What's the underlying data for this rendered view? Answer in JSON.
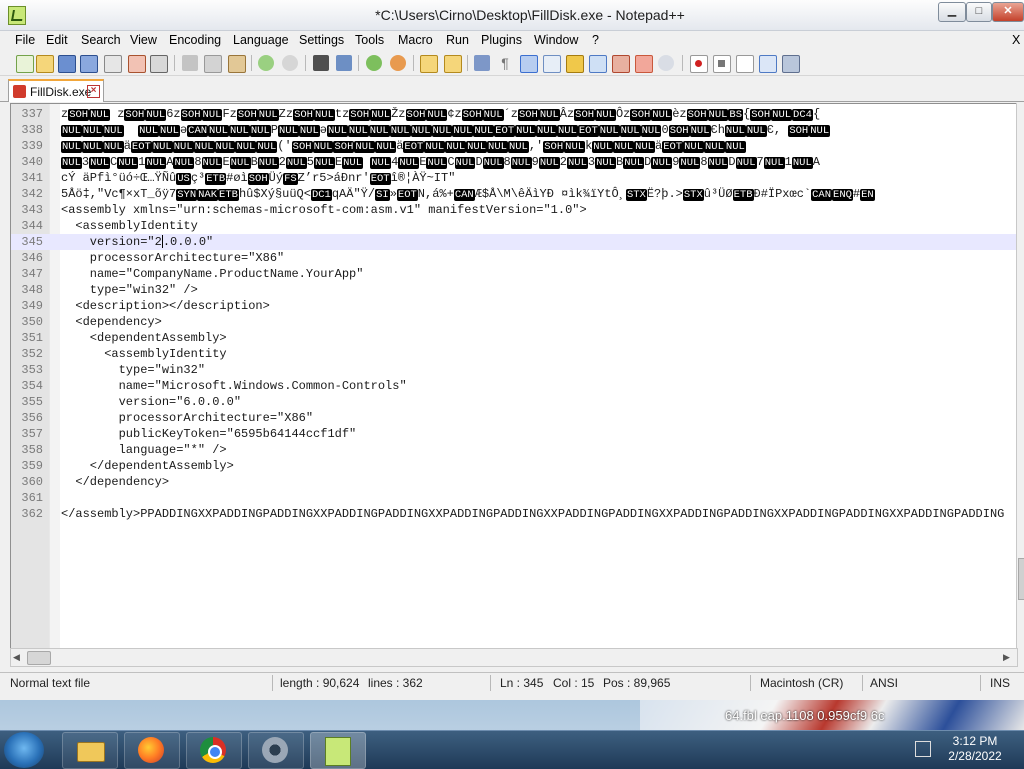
{
  "window": {
    "title": "*C:\\Users\\Cirno\\Desktop\\FillDisk.exe - Notepad++"
  },
  "menu": [
    "File",
    "Edit",
    "Search",
    "View",
    "Encoding",
    "Language",
    "Settings",
    "Tools",
    "Macro",
    "Run",
    "Plugins",
    "Window",
    "?"
  ],
  "tab": {
    "label": "FillDisk.exe"
  },
  "editor": {
    "lines": [
      {
        "num": "337",
        "segments": [
          {
            "t": "z"
          },
          {
            "t": "SOH",
            "c": 1
          },
          {
            "t": "NUL",
            "c": 1
          },
          {
            "t": " z"
          },
          {
            "t": "SOH",
            "c": 1
          },
          {
            "t": "NUL",
            "c": 1
          },
          {
            "t": "6z"
          },
          {
            "t": "SOH",
            "c": 1
          },
          {
            "t": "NUL",
            "c": 1
          },
          {
            "t": "Fz"
          },
          {
            "t": "SOH",
            "c": 1
          },
          {
            "t": "NUL",
            "c": 1
          },
          {
            "t": "Zz"
          },
          {
            "t": "SOH",
            "c": 1
          },
          {
            "t": "NUL",
            "c": 1
          },
          {
            "t": "tz"
          },
          {
            "t": "SOH",
            "c": 1
          },
          {
            "t": "NUL",
            "c": 1
          },
          {
            "t": "Žz"
          },
          {
            "t": "SOH",
            "c": 1
          },
          {
            "t": "NUL",
            "c": 1
          },
          {
            "t": "¢z"
          },
          {
            "t": "SOH",
            "c": 1
          },
          {
            "t": "NUL",
            "c": 1
          },
          {
            "t": "´z"
          },
          {
            "t": "SOH",
            "c": 1
          },
          {
            "t": "NUL",
            "c": 1
          },
          {
            "t": "Âz"
          },
          {
            "t": "SOH",
            "c": 1
          },
          {
            "t": "NUL",
            "c": 1
          },
          {
            "t": "Ôz"
          },
          {
            "t": "SOH",
            "c": 1
          },
          {
            "t": "NUL",
            "c": 1
          },
          {
            "t": "èz"
          },
          {
            "t": "SOH",
            "c": 1
          },
          {
            "t": "NUL",
            "c": 1
          },
          {
            "t": "BS",
            "c": 1
          },
          {
            "t": "{"
          },
          {
            "t": "SOH",
            "c": 1
          },
          {
            "t": "NUL",
            "c": 1
          },
          {
            "t": "DC4",
            "c": 1
          },
          {
            "t": "{"
          }
        ]
      },
      {
        "num": "338",
        "segments": [
          {
            "t": "NUL",
            "c": 1
          },
          {
            "t": "NUL",
            "c": 1
          },
          {
            "t": "NUL",
            "c": 1
          },
          {
            "t": "  "
          },
          {
            "t": "NUL",
            "c": 1
          },
          {
            "t": "NUL",
            "c": 1
          },
          {
            "t": "ә"
          },
          {
            "t": "CAN",
            "c": 1
          },
          {
            "t": "NUL",
            "c": 1
          },
          {
            "t": "NUL",
            "c": 1
          },
          {
            "t": "NUL",
            "c": 1
          },
          {
            "t": "P"
          },
          {
            "t": "NUL",
            "c": 1
          },
          {
            "t": "NUL",
            "c": 1
          },
          {
            "t": "ә"
          },
          {
            "t": "NUL",
            "c": 1
          },
          {
            "t": "NUL",
            "c": 1
          },
          {
            "t": "NUL",
            "c": 1
          },
          {
            "t": "NUL",
            "c": 1
          },
          {
            "t": "NUL",
            "c": 1
          },
          {
            "t": "NUL",
            "c": 1
          },
          {
            "t": "NUL",
            "c": 1
          },
          {
            "t": "NUL",
            "c": 1
          },
          {
            "t": "EOT",
            "c": 1
          },
          {
            "t": "NUL",
            "c": 1
          },
          {
            "t": "NUL",
            "c": 1
          },
          {
            "t": "NUL",
            "c": 1
          },
          {
            "t": "EOT",
            "c": 1
          },
          {
            "t": "NUL",
            "c": 1
          },
          {
            "t": "NUL",
            "c": 1
          },
          {
            "t": "NUL",
            "c": 1
          },
          {
            "t": "0"
          },
          {
            "t": "SOH",
            "c": 1
          },
          {
            "t": "NUL",
            "c": 1
          },
          {
            "t": "Єh"
          },
          {
            "t": "NUL",
            "c": 1
          },
          {
            "t": "NUL",
            "c": 1
          },
          {
            "t": "Є, "
          },
          {
            "t": "SOH",
            "c": 1
          },
          {
            "t": "NUL",
            "c": 1
          }
        ]
      },
      {
        "num": "339",
        "segments": [
          {
            "t": "NUL",
            "c": 1
          },
          {
            "t": "NUL",
            "c": 1
          },
          {
            "t": "NUL",
            "c": 1
          },
          {
            "t": "ä"
          },
          {
            "t": "EOT",
            "c": 1
          },
          {
            "t": "NUL",
            "c": 1
          },
          {
            "t": "NUL",
            "c": 1
          },
          {
            "t": "NUL",
            "c": 1
          },
          {
            "t": "NUL",
            "c": 1
          },
          {
            "t": "NUL",
            "c": 1
          },
          {
            "t": "NUL",
            "c": 1
          },
          {
            "t": "('"
          },
          {
            "t": "SOH",
            "c": 1
          },
          {
            "t": "NUL",
            "c": 1
          },
          {
            "t": "SOH",
            "c": 1
          },
          {
            "t": "NUL",
            "c": 1
          },
          {
            "t": "NUL",
            "c": 1
          },
          {
            "t": "ä"
          },
          {
            "t": "EOT",
            "c": 1
          },
          {
            "t": "NUL",
            "c": 1
          },
          {
            "t": "NUL",
            "c": 1
          },
          {
            "t": "NUL",
            "c": 1
          },
          {
            "t": "NUL",
            "c": 1
          },
          {
            "t": "NUL",
            "c": 1
          },
          {
            "t": ",'"
          },
          {
            "t": "SOH",
            "c": 1
          },
          {
            "t": "NUL",
            "c": 1
          },
          {
            "t": "k"
          },
          {
            "t": "NUL",
            "c": 1
          },
          {
            "t": "NUL",
            "c": 1
          },
          {
            "t": "NUL",
            "c": 1
          },
          {
            "t": "ä"
          },
          {
            "t": "EOT",
            "c": 1
          },
          {
            "t": "NUL",
            "c": 1
          },
          {
            "t": "NUL",
            "c": 1
          },
          {
            "t": "NUL",
            "c": 1
          }
        ]
      },
      {
        "num": "340",
        "segments": [
          {
            "t": "NUL",
            "c": 1
          },
          {
            "t": "3"
          },
          {
            "t": "NUL",
            "c": 1
          },
          {
            "t": "C"
          },
          {
            "t": "NUL",
            "c": 1
          },
          {
            "t": "1"
          },
          {
            "t": "NUL",
            "c": 1
          },
          {
            "t": "A"
          },
          {
            "t": "NUL",
            "c": 1
          },
          {
            "t": "8"
          },
          {
            "t": "NUL",
            "c": 1
          },
          {
            "t": "E"
          },
          {
            "t": "NUL",
            "c": 1
          },
          {
            "t": "B"
          },
          {
            "t": "NUL",
            "c": 1
          },
          {
            "t": "2"
          },
          {
            "t": "NUL",
            "c": 1
          },
          {
            "t": "5"
          },
          {
            "t": "NUL",
            "c": 1
          },
          {
            "t": "E"
          },
          {
            "t": "NUL",
            "c": 1
          },
          {
            "t": " "
          },
          {
            "t": "NUL",
            "c": 1
          },
          {
            "t": "4"
          },
          {
            "t": "NUL",
            "c": 1
          },
          {
            "t": "E"
          },
          {
            "t": "NUL",
            "c": 1
          },
          {
            "t": "C"
          },
          {
            "t": "NUL",
            "c": 1
          },
          {
            "t": "D"
          },
          {
            "t": "NUL",
            "c": 1
          },
          {
            "t": "8"
          },
          {
            "t": "NUL",
            "c": 1
          },
          {
            "t": "9"
          },
          {
            "t": "NUL",
            "c": 1
          },
          {
            "t": "2"
          },
          {
            "t": "NUL",
            "c": 1
          },
          {
            "t": "3"
          },
          {
            "t": "NUL",
            "c": 1
          },
          {
            "t": "B"
          },
          {
            "t": "NUL",
            "c": 1
          },
          {
            "t": "D"
          },
          {
            "t": "NUL",
            "c": 1
          },
          {
            "t": "9"
          },
          {
            "t": "NUL",
            "c": 1
          },
          {
            "t": "8"
          },
          {
            "t": "NUL",
            "c": 1
          },
          {
            "t": "D"
          },
          {
            "t": "NUL",
            "c": 1
          },
          {
            "t": "7"
          },
          {
            "t": "NUL",
            "c": 1
          },
          {
            "t": "1"
          },
          {
            "t": "NUL",
            "c": 1
          },
          {
            "t": "A"
          }
        ]
      },
      {
        "num": "341",
        "segments": [
          {
            "t": "cÝ äPfì°üó÷Œ…ŸÑû"
          },
          {
            "t": "US",
            "c": 1
          },
          {
            "t": "ç³"
          },
          {
            "t": "ETB",
            "c": 1
          },
          {
            "t": "#øì"
          },
          {
            "t": "SOH",
            "c": 1
          },
          {
            "t": "Üý"
          },
          {
            "t": "FS",
            "c": 1
          },
          {
            "t": "Z’r5>áÐnr'"
          },
          {
            "t": "EOT",
            "c": 1
          },
          {
            "t": "î®¦ÀŸ~IT\""
          }
        ]
      },
      {
        "num": "342",
        "segments": [
          {
            "t": "5Åö‡,\"Vc¶×xT_õÿ7"
          },
          {
            "t": "SYN",
            "c": 1
          },
          {
            "t": "NAK",
            "c": 1
          },
          {
            "t": "ETB",
            "c": 1
          },
          {
            "t": "hû$Xý§uüQ<"
          },
          {
            "t": "DC1",
            "c": 1
          },
          {
            "t": "qAÄ\"Ÿ/"
          },
          {
            "t": "SI",
            "c": 1
          },
          {
            "t": "»"
          },
          {
            "t": "EOT",
            "c": 1
          },
          {
            "t": "N,á%+"
          },
          {
            "t": "CAN",
            "c": 1
          },
          {
            "t": "Æ$Å\\M\\êÄìYÐ ¤ìk¾ïYtÔ¸"
          },
          {
            "t": "STX",
            "c": 1
          },
          {
            "t": "Ë?þ.>"
          },
          {
            "t": "STX",
            "c": 1
          },
          {
            "t": "û³ÜØ"
          },
          {
            "t": "ETB",
            "c": 1
          },
          {
            "t": "Ð#ÏPxœc`"
          },
          {
            "t": "CAN",
            "c": 1
          },
          {
            "t": "ENQ",
            "c": 1
          },
          {
            "t": "#"
          },
          {
            "t": "EN",
            "c": 1
          }
        ]
      },
      {
        "num": "343",
        "segments": [
          {
            "t": "<assembly xmlns=\"urn:schemas-microsoft-com:asm.v1\" manifestVersion=\"1.0\">"
          }
        ]
      },
      {
        "num": "344",
        "segments": [
          {
            "t": "  <assemblyIdentity"
          }
        ]
      },
      {
        "num": "345",
        "current": true,
        "before": "    version=\"2",
        "after": ".0.0.0\""
      },
      {
        "num": "346",
        "segments": [
          {
            "t": "    processorArchitecture=\"X86\""
          }
        ]
      },
      {
        "num": "347",
        "segments": [
          {
            "t": "    name=\"CompanyName.ProductName.YourApp\""
          }
        ]
      },
      {
        "num": "348",
        "segments": [
          {
            "t": "    type=\"win32\" />"
          }
        ]
      },
      {
        "num": "349",
        "segments": [
          {
            "t": "  <description></description>"
          }
        ]
      },
      {
        "num": "350",
        "segments": [
          {
            "t": "  <dependency>"
          }
        ]
      },
      {
        "num": "351",
        "segments": [
          {
            "t": "    <dependentAssembly>"
          }
        ]
      },
      {
        "num": "352",
        "segments": [
          {
            "t": "      <assemblyIdentity"
          }
        ]
      },
      {
        "num": "353",
        "segments": [
          {
            "t": "        type=\"win32\""
          }
        ]
      },
      {
        "num": "354",
        "segments": [
          {
            "t": "        name=\"Microsoft.Windows.Common-Controls\""
          }
        ]
      },
      {
        "num": "355",
        "segments": [
          {
            "t": "        version=\"6.0.0.0\""
          }
        ]
      },
      {
        "num": "356",
        "segments": [
          {
            "t": "        processorArchitecture=\"X86\""
          }
        ]
      },
      {
        "num": "357",
        "segments": [
          {
            "t": "        publicKeyToken=\"6595b64144ccf1df\""
          }
        ]
      },
      {
        "num": "358",
        "segments": [
          {
            "t": "        language=\"*\" />"
          }
        ]
      },
      {
        "num": "359",
        "segments": [
          {
            "t": "    </dependentAssembly>"
          }
        ]
      },
      {
        "num": "360",
        "segments": [
          {
            "t": "  </dependency>"
          }
        ]
      },
      {
        "num": "361",
        "segments": [
          {
            "t": ""
          }
        ]
      },
      {
        "num": "362",
        "segments": [
          {
            "t": "</assembly>PPADDINGXXPADDINGPADDINGXXPADDINGPADDINGXXPADDINGPADDINGXXPADDINGPADDINGXXPADDINGPADDINGXXPADDINGPADDINGXXPADDINGPADDING"
          }
        ]
      }
    ]
  },
  "status": {
    "file_type": "Normal text file",
    "length": "length : 90,624",
    "lines": "lines : 362",
    "ln": "Ln : 345",
    "col": "Col : 15",
    "pos": "Pos : 89,965",
    "eol": "Macintosh (CR)",
    "encoding": "ANSI",
    "mode": "INS"
  },
  "background_text": "64.fbl   eap.1108   0.959cf9   6c",
  "clock": {
    "time": "3:12 PM",
    "date": "2/28/2022"
  },
  "icons": {
    "toolbar": [
      "new-file-icon",
      "open-file-icon",
      "save-icon",
      "save-all-icon",
      "close-icon",
      "close-all-icon",
      "print-icon",
      "cut-icon",
      "copy-icon",
      "paste-icon",
      "undo-icon",
      "redo-icon",
      "find-icon",
      "replace-icon",
      "zoom-in-icon",
      "zoom-out-icon",
      "sync-vertical-icon",
      "sync-horizontal-icon",
      "word-wrap-icon",
      "show-all-chars-icon",
      "indent-guide-icon",
      "document-map-icon",
      "function-list-icon",
      "folder-as-workspace-icon",
      "monitoring-icon",
      "record-macro-icon",
      "stop-macro-icon",
      "play-macro-icon",
      "run-macro-multiple-icon",
      "save-macro-icon"
    ],
    "taskbar": [
      "windows-start-icon",
      "file-explorer-icon",
      "firefox-icon",
      "chrome-icon",
      "settings-icon",
      "notepad-plus-plus-icon"
    ]
  }
}
